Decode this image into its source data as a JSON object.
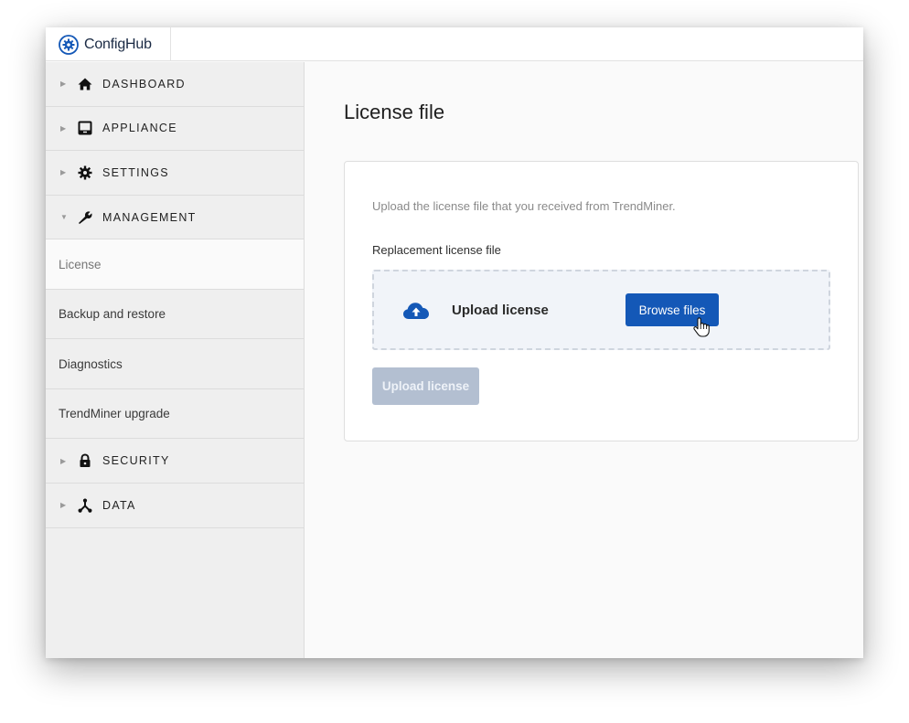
{
  "app": {
    "name": "ConfigHub"
  },
  "sidebar": {
    "sections_top": [
      {
        "label": "DASHBOARD",
        "icon": "home-icon",
        "expanded": false
      },
      {
        "label": "APPLIANCE",
        "icon": "monitor-icon",
        "expanded": false
      },
      {
        "label": "SETTINGS",
        "icon": "gear-icon",
        "expanded": false
      },
      {
        "label": "MANAGEMENT",
        "icon": "wrench-icon",
        "expanded": true
      }
    ],
    "management_items": [
      {
        "label": "License",
        "active": true
      },
      {
        "label": "Backup and restore",
        "active": false
      },
      {
        "label": "Diagnostics",
        "active": false
      },
      {
        "label": "TrendMiner upgrade",
        "active": false
      }
    ],
    "sections_bottom": [
      {
        "label": "SECURITY",
        "icon": "lock-icon",
        "expanded": false
      },
      {
        "label": "DATA",
        "icon": "network-icon",
        "expanded": false
      }
    ]
  },
  "main": {
    "title": "License file",
    "card": {
      "description": "Upload the license file that you received from TrendMiner.",
      "field_label": "Replacement license file",
      "dropzone": {
        "label": "Upload license",
        "browse_button": "Browse files"
      },
      "upload_button": "Upload license",
      "upload_button_enabled": false
    }
  },
  "colors": {
    "primary": "#1458b7",
    "disabled_button": "#b3bfd1",
    "sidebar_bg": "#efefef",
    "logo": "#1458b7"
  }
}
